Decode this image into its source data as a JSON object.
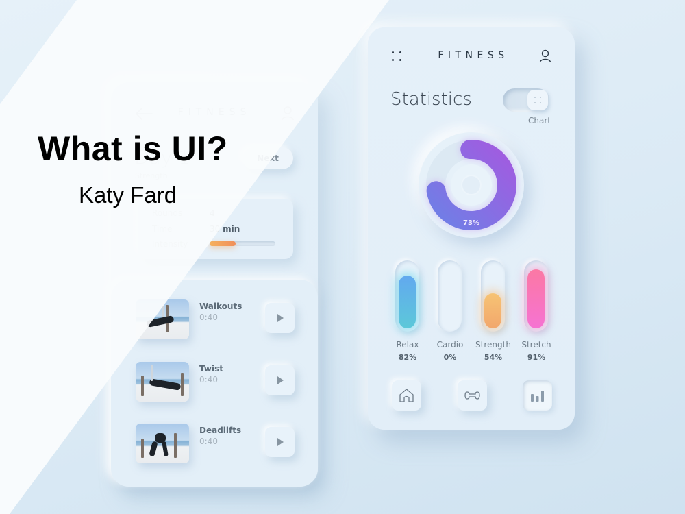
{
  "overlay": {
    "title": "What is UI?",
    "author": "Katy Fard"
  },
  "workout_screen": {
    "header_title": "FITNESS",
    "day_title": "Day 1",
    "day_subtitle": "Strength",
    "next_button": "Next",
    "details": [
      {
        "label": "Rounds",
        "value": "4"
      },
      {
        "label": "Time",
        "value": "30",
        "unit": "min"
      },
      {
        "label": "Intensity",
        "progress": 0.4
      }
    ],
    "exercises": [
      {
        "name": "Walkouts",
        "duration": "0:40"
      },
      {
        "name": "Twist",
        "duration": "0:40"
      },
      {
        "name": "Deadlifts",
        "duration": "0:40"
      }
    ]
  },
  "stats_screen": {
    "header_title": "FITNESS",
    "page_title": "Statistics",
    "toggle_label": "Chart",
    "toggle_on": true,
    "overall": {
      "percent": 73,
      "label": "73%"
    },
    "categories": [
      {
        "name": "Relax",
        "percent": 82,
        "label": "82%",
        "colors": [
          "#62a9ef",
          "#5cc8d9"
        ],
        "glow": "rgba(80,210,235,0.55)"
      },
      {
        "name": "Cardio",
        "percent": 0,
        "label": "0%",
        "colors": [
          "#e8f2fa",
          "#e8f2fa"
        ],
        "glow": "rgba(0,0,0,0)"
      },
      {
        "name": "Strength",
        "percent": 54,
        "label": "54%",
        "colors": [
          "#f6c374",
          "#f2a76c"
        ],
        "glow": "rgba(248,180,110,0.55)"
      },
      {
        "name": "Stretch",
        "percent": 91,
        "label": "91%",
        "colors": [
          "#fb78a4",
          "#f673d2"
        ],
        "glow": "rgba(250,120,190,0.5)"
      }
    ],
    "nav": [
      {
        "icon": "home-icon",
        "active": false
      },
      {
        "icon": "dumbbell-icon",
        "active": false
      },
      {
        "icon": "bar-chart-icon",
        "active": true
      }
    ],
    "colors": {
      "donut_start": "#6f7fe6",
      "donut_end": "#a25be0",
      "accent_text": "#2c3946"
    }
  }
}
